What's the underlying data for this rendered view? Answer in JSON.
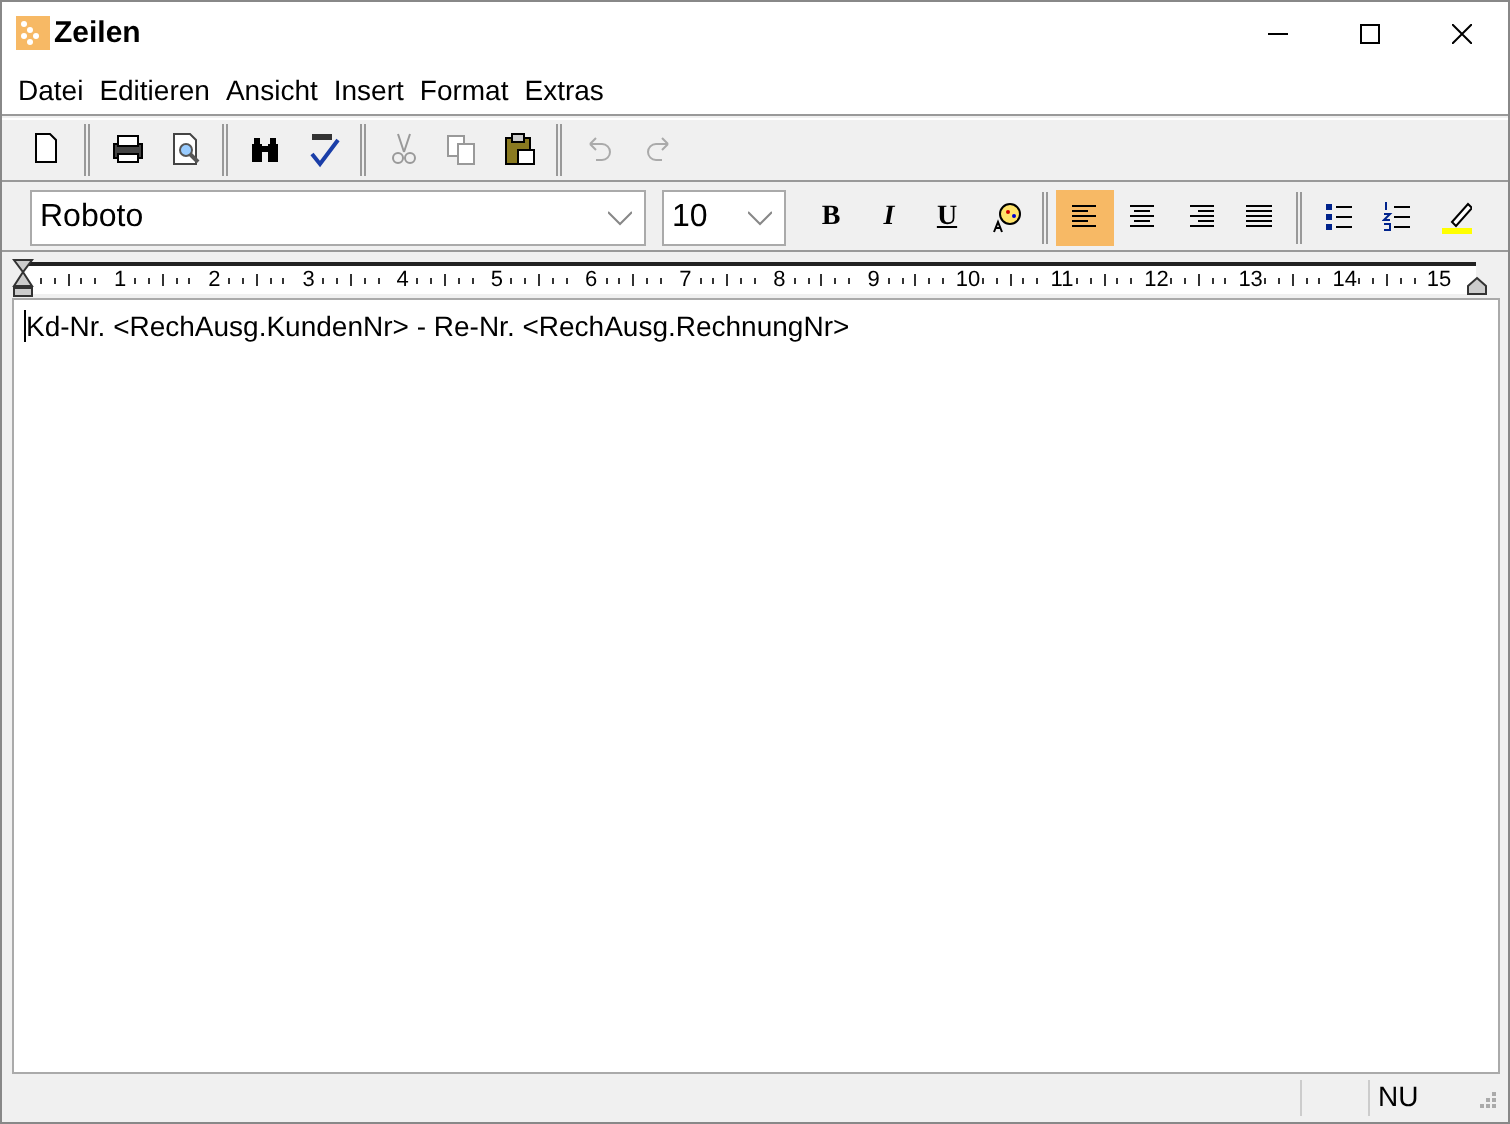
{
  "window": {
    "title": "Zeilen"
  },
  "menu": [
    "Datei",
    "Editieren",
    "Ansicht",
    "Insert",
    "Format",
    "Extras"
  ],
  "toolbar": [
    {
      "kind": "new",
      "disabled": false
    },
    {
      "kind": "sep"
    },
    {
      "kind": "print",
      "disabled": false
    },
    {
      "kind": "preview",
      "disabled": false
    },
    {
      "kind": "sep"
    },
    {
      "kind": "find",
      "disabled": false
    },
    {
      "kind": "spell",
      "disabled": false
    },
    {
      "kind": "sep"
    },
    {
      "kind": "cut",
      "disabled": true
    },
    {
      "kind": "copy",
      "disabled": true
    },
    {
      "kind": "paste",
      "disabled": false
    },
    {
      "kind": "sep"
    },
    {
      "kind": "undo",
      "disabled": true
    },
    {
      "kind": "redo",
      "disabled": true
    }
  ],
  "format_bar": {
    "font": {
      "value": "Roboto"
    },
    "size": {
      "value": "10"
    },
    "buttons": [
      {
        "kind": "bold",
        "label": "B",
        "selected": false
      },
      {
        "kind": "italic",
        "label": "I",
        "selected": false
      },
      {
        "kind": "underline",
        "label": "U",
        "selected": false
      },
      {
        "kind": "color",
        "selected": false
      },
      {
        "kind": "sep"
      },
      {
        "kind": "align-left",
        "selected": true
      },
      {
        "kind": "align-center",
        "selected": false
      },
      {
        "kind": "align-right",
        "selected": false
      },
      {
        "kind": "justify",
        "selected": false
      },
      {
        "kind": "sep"
      },
      {
        "kind": "bullets",
        "selected": false
      },
      {
        "kind": "numbering",
        "selected": false
      },
      {
        "kind": "highlight",
        "selected": false
      }
    ]
  },
  "ruler": {
    "labels": [
      "1",
      "2",
      "3",
      "4",
      "5",
      "6",
      "7",
      "8",
      "9",
      "10",
      "11",
      "12",
      "13",
      "14",
      "15"
    ]
  },
  "editor": {
    "text": "Kd-Nr. <RechAusg.KundenNr> - Re-Nr. <RechAusg.RechnungNr>"
  },
  "status_bar": {
    "indicator": "NU"
  }
}
